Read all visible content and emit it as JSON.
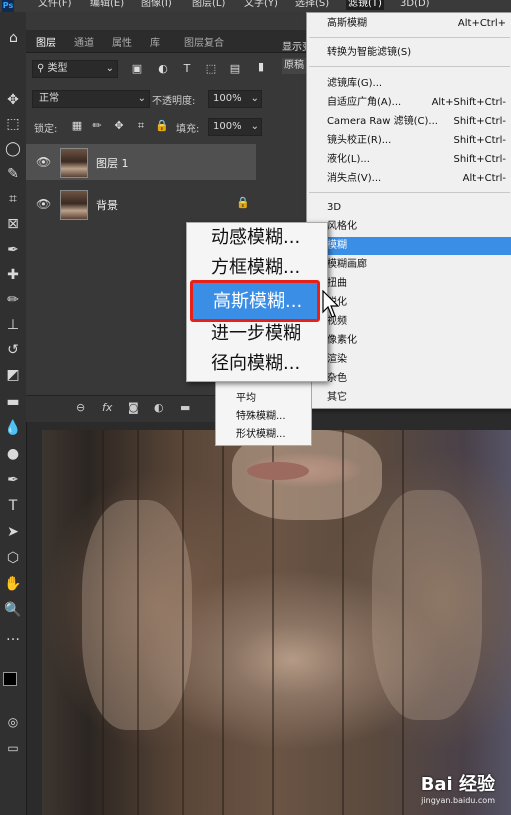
{
  "menubar": {
    "ps_logo": "Ps",
    "items": [
      "文件(F)",
      "编辑(E)",
      "图像(I)",
      "图层(L)",
      "文字(Y)",
      "选择(S)",
      "滤镜(T)",
      "3D(D)"
    ]
  },
  "panel": {
    "tabs": [
      "图层",
      "通道",
      "属性",
      "库",
      "图层复合"
    ],
    "kind_filter": "类型",
    "blend_mode": "正常",
    "opacity_label": "不透明度:",
    "opacity_value": "100%",
    "lock_label": "锁定:",
    "fill_label": "填充:",
    "fill_value": "100%",
    "layers": [
      {
        "name": "图层 1"
      },
      {
        "name": "背景"
      }
    ]
  },
  "fragments": {
    "top_right": "显示变",
    "doc_tab": "原稿"
  },
  "filter_menu": {
    "items": [
      {
        "label": "高斯模糊",
        "shortcut": "Alt+Ctrl+"
      },
      {
        "label": "转换为智能滤镜(S)",
        "shortcut": ""
      },
      {
        "label": "滤镜库(G)...",
        "shortcut": ""
      },
      {
        "label": "自适应广角(A)...",
        "shortcut": "Alt+Shift+Ctrl-"
      },
      {
        "label": "Camera Raw 滤镜(C)...",
        "shortcut": "Shift+Ctrl-"
      },
      {
        "label": "镜头校正(R)...",
        "shortcut": "Shift+Ctrl-"
      },
      {
        "label": "液化(L)...",
        "shortcut": "Shift+Ctrl-"
      },
      {
        "label": "消失点(V)...",
        "shortcut": "Alt+Ctrl-"
      },
      {
        "label": "3D",
        "shortcut": ""
      },
      {
        "label": "风格化",
        "shortcut": ""
      },
      {
        "label": "模糊",
        "shortcut": ""
      },
      {
        "label": "模糊画廊",
        "shortcut": ""
      },
      {
        "label": "扭曲",
        "shortcut": ""
      },
      {
        "label": "锐化",
        "shortcut": ""
      },
      {
        "label": "视频",
        "shortcut": ""
      },
      {
        "label": "像素化",
        "shortcut": ""
      },
      {
        "label": "渲染",
        "shortcut": ""
      },
      {
        "label": "杂色",
        "shortcut": ""
      },
      {
        "label": "其它",
        "shortcut": ""
      }
    ]
  },
  "blur_submenu": {
    "items": [
      "动感模糊...",
      "方框模糊...",
      "高斯模糊...",
      "进一步模糊",
      "径向模糊..."
    ],
    "selected": "高斯模糊..."
  },
  "blur_submenu_lower": {
    "items": [
      "平均",
      "特殊模糊...",
      "形状模糊..."
    ]
  },
  "watermark": {
    "brand": "Bai 经验",
    "url": "jingyan.baidu.com"
  },
  "colors": {
    "highlight": "#3a8ee6",
    "selection_border": "#e8201a",
    "panel_bg": "#383838"
  }
}
